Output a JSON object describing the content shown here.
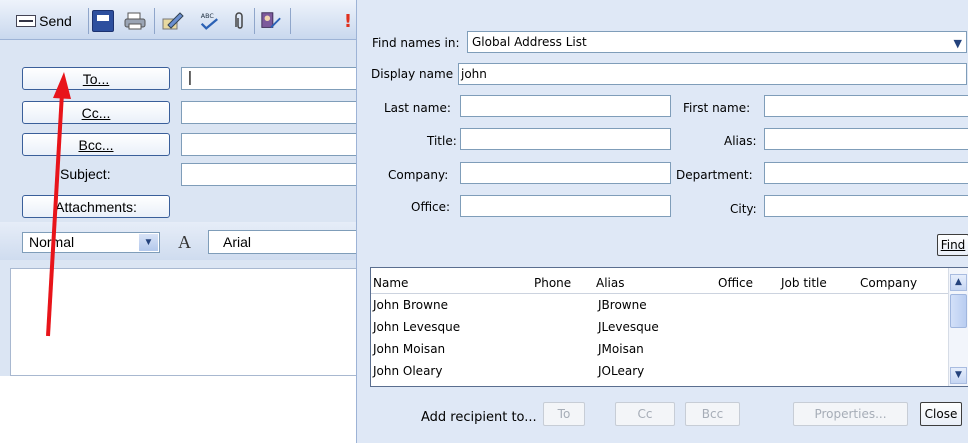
{
  "compose": {
    "toolbar": {
      "send_label": "Send",
      "icons": [
        "save-icon",
        "print-icon",
        "edit-icon",
        "spell-check-icon",
        "attach-icon",
        "address-book-icon",
        "importance-icon"
      ]
    },
    "to_label": "To...",
    "to_value": "|",
    "cc_label": "Cc...",
    "bcc_label": "Bcc...",
    "subject_label": "Subject:",
    "attachments_label": "Attachments:",
    "style_value": "Normal",
    "font_value": "Arial"
  },
  "address_book": {
    "find_in_label": "Find names in:",
    "find_in_value": "Global Address List",
    "display_name_label": "Display name",
    "display_name_value": "john",
    "last_name_label": "Last name:",
    "first_name_label": "First name:",
    "title_label": "Title:",
    "alias_label": "Alias:",
    "company_label": "Company:",
    "department_label": "Department:",
    "office_label": "Office:",
    "city_label": "City:",
    "find_button": "Find",
    "columns": [
      "Name",
      "Phone",
      "Alias",
      "Office",
      "Job title",
      "Company"
    ],
    "rows": [
      {
        "name": "John Browne",
        "alias": "JBrowne"
      },
      {
        "name": "John Levesque",
        "alias": "JLevesque"
      },
      {
        "name": "John Moisan",
        "alias": "JMoisan"
      },
      {
        "name": "John Oleary",
        "alias": "JOLeary"
      }
    ],
    "add_recipient_label": "Add recipient to...",
    "to_button": "To",
    "cc_button": "Cc",
    "bcc_button": "Bcc",
    "properties_button": "Properties...",
    "close_button": "Close"
  },
  "colors": {
    "arrow": "#e8141a",
    "accent": "#3a5f9a"
  }
}
